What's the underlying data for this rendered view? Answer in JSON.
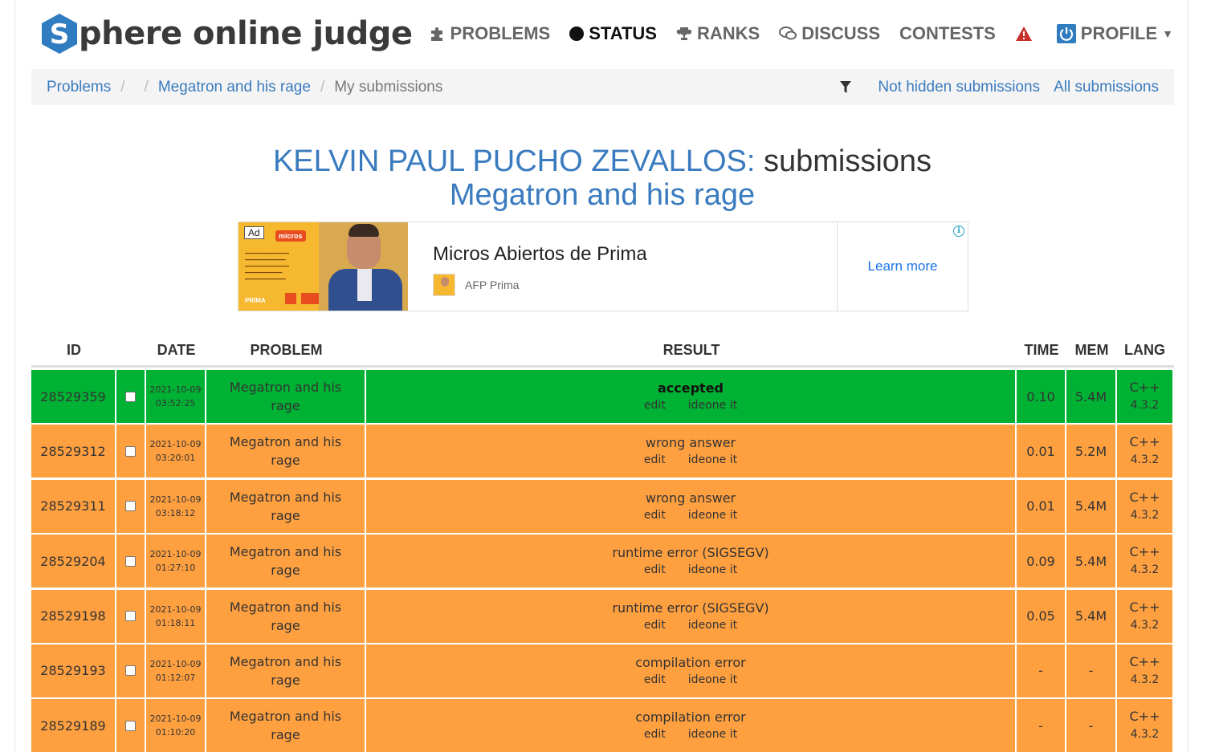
{
  "header": {
    "logo_letter": "S",
    "logo_text": "phere online judge",
    "nav": [
      {
        "label": "PROBLEMS",
        "icon": "puzzle-icon"
      },
      {
        "label": "STATUS",
        "icon": "circle-icon"
      },
      {
        "label": "RANKS",
        "icon": "trophy-icon"
      },
      {
        "label": "DISCUSS",
        "icon": "chat-bubbles-icon"
      },
      {
        "label": "CONTESTS",
        "icon": ""
      },
      {
        "label": "PROFILE",
        "icon": "power-icon"
      }
    ],
    "alert_icon": "warning-icon"
  },
  "breadcrumb": {
    "items": [
      "Problems",
      "",
      "Megatron and his rage",
      "My submissions"
    ],
    "filter_icon": "filter-icon",
    "links": [
      "Not hidden submissions",
      "All submissions"
    ]
  },
  "title": {
    "user": "KELVIN PAUL PUCHO ZEVALLOS:",
    "suffix": "submissions",
    "problem": "Megatron and his rage"
  },
  "ad": {
    "badge": "Ad",
    "headline": "Micros Abiertos de Prima",
    "advertiser": "AFP Prima",
    "cta": "Learn more",
    "info": "i"
  },
  "table": {
    "headers": [
      "ID",
      "",
      "DATE",
      "PROBLEM",
      "RESULT",
      "TIME",
      "MEM",
      "LANG"
    ],
    "link_edit": "edit",
    "link_ideone": "ideone it",
    "rows": [
      {
        "id": "28529359",
        "date": "2021-10-09",
        "time_of_day": "03:52:25",
        "problem": "Megatron and his rage",
        "result": "accepted",
        "status": "ok",
        "time": "0.10",
        "mem": "5.4M",
        "lang": "C++",
        "lang_ver": "4.3.2"
      },
      {
        "id": "28529312",
        "date": "2021-10-09",
        "time_of_day": "03:20:01",
        "problem": "Megatron and his rage",
        "result": "wrong answer",
        "status": "bad",
        "time": "0.01",
        "mem": "5.2M",
        "lang": "C++",
        "lang_ver": "4.3.2"
      },
      {
        "id": "28529311",
        "date": "2021-10-09",
        "time_of_day": "03:18:12",
        "problem": "Megatron and his rage",
        "result": "wrong answer",
        "status": "bad",
        "time": "0.01",
        "mem": "5.4M",
        "lang": "C++",
        "lang_ver": "4.3.2"
      },
      {
        "id": "28529204",
        "date": "2021-10-09",
        "time_of_day": "01:27:10",
        "problem": "Megatron and his rage",
        "result": "runtime error (SIGSEGV)",
        "status": "bad",
        "time": "0.09",
        "mem": "5.4M",
        "lang": "C++",
        "lang_ver": "4.3.2"
      },
      {
        "id": "28529198",
        "date": "2021-10-09",
        "time_of_day": "01:18:11",
        "problem": "Megatron and his rage",
        "result": "runtime error (SIGSEGV)",
        "status": "bad",
        "time": "0.05",
        "mem": "5.4M",
        "lang": "C++",
        "lang_ver": "4.3.2"
      },
      {
        "id": "28529193",
        "date": "2021-10-09",
        "time_of_day": "01:12:07",
        "problem": "Megatron and his rage",
        "result": "compilation error",
        "status": "bad",
        "time": "-",
        "mem": "-",
        "lang": "C++",
        "lang_ver": "4.3.2"
      },
      {
        "id": "28529189",
        "date": "2021-10-09",
        "time_of_day": "01:10:20",
        "problem": "Megatron and his rage",
        "result": "compilation error",
        "status": "bad",
        "time": "-",
        "mem": "-",
        "lang": "C++",
        "lang_ver": "4.3.2"
      }
    ]
  },
  "colors": {
    "accepted": "#00b233",
    "error": "#ffa040",
    "link": "#3a7bbf",
    "logo_blue": "#2f7cc0"
  }
}
